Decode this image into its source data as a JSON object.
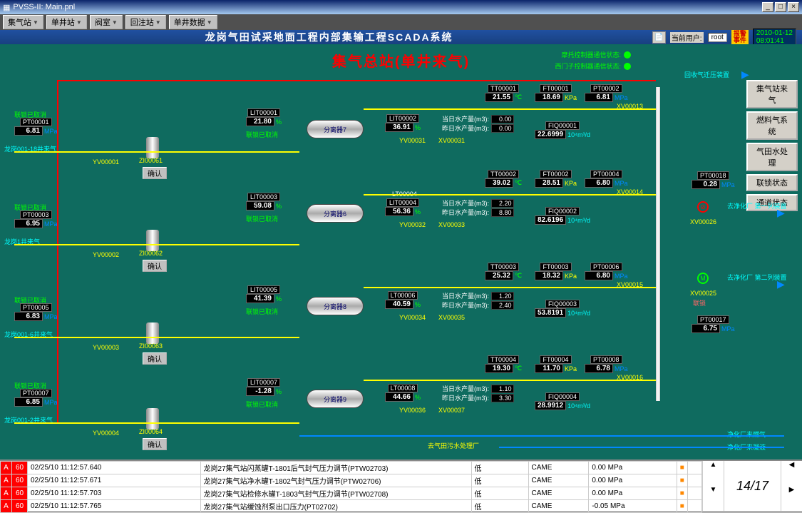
{
  "window": {
    "title": "PVSS-II: Main.pnl"
  },
  "toolbar": {
    "b1": "集气站",
    "b2": "单井站",
    "b3": "阀室",
    "b4": "回注站",
    "b5": "单井数据"
  },
  "header": {
    "title": "龙岗气田试采地面工程内部集输工程SCADA系统",
    "userlbl": "当前用户:",
    "user": "root",
    "alarm": "报警\n事件",
    "date": "2010-01-12",
    "time": "08:01:41"
  },
  "subtitle": "集气总站(单井来气)",
  "status": {
    "s1": "摩托控制器通信状态:",
    "s2": "西门子控制器通信状态:"
  },
  "sidebtns": {
    "b1": "集气站来气",
    "b2": "燃料气系统",
    "b3": "气田水处理",
    "b4": "联锁状态",
    "b5": "通道状态"
  },
  "pt": {
    "PT00001": "6.81",
    "PT00002": "6.81",
    "PT00003": "6.95",
    "PT00004": "6.80",
    "PT00005": "6.83",
    "PT00006": "6.80",
    "PT00007": "6.85",
    "PT00008": "6.78",
    "PT00017": "6.75",
    "PT00018": "0.28"
  },
  "tt": {
    "TT00001": "21.55",
    "TT00002": "39.02",
    "TT00003": "25.32",
    "TT00004": "19.30"
  },
  "ft": {
    "FT00001": "18.69",
    "FT00002": "28.51",
    "FT00003": "18.32",
    "FT00004": "11.70"
  },
  "lit": {
    "LIT00001": "21.80",
    "LIT00002": "36.91",
    "LIT00003": "59.08",
    "LIT00004": "56.36",
    "LIT00005": "41.39",
    "LIT00006": "40.59",
    "LIT00007": "-1.28",
    "LIT00008": "44.66"
  },
  "fiq": {
    "FIQ00001": "22.6999",
    "FIQ00002": "82.6196",
    "FIQ00003": "53.8191",
    "FIQ00004": "28.9912"
  },
  "yv": {
    "1": "YV00001",
    "2": "YV00002",
    "3": "YV00003",
    "4": "YV00004",
    "31": "YV00031",
    "32": "YV00032",
    "34": "YV00034",
    "36": "YV00036"
  },
  "xv": {
    "13": "XV00013",
    "14": "XV00014",
    "15": "XV00015",
    "16": "XV00016",
    "25": "XV00025",
    "26": "XV00026",
    "31": "XV00031",
    "33": "XV00033",
    "35": "XV00035",
    "37": "XV00037"
  },
  "zi": {
    "61": "ZI00061",
    "62": "ZI00062",
    "63": "ZI00063",
    "64": "ZI00064"
  },
  "lt": {
    "4": "LT00004",
    "6": "LT00006",
    "8": "LT00008"
  },
  "sep": {
    "7": "分离器7",
    "6": "分离器6",
    "8": "分离器8",
    "9": "分离器9"
  },
  "confirm": "确认",
  "lock": "联锁已取消",
  "day": {
    "today": "当日水产量(m3):",
    "yest": "昨日水产量(m3):"
  },
  "dv": {
    "1a": "0.00",
    "1b": "0.00",
    "2a": "2.20",
    "2b": "8.80",
    "3a": "1.20",
    "3b": "2.40",
    "4a": "1.10",
    "4b": "3.30"
  },
  "labels": {
    "l1": "龙岗001-18井来气",
    "l2": "龙岗1井来气",
    "l3": "龙岗001-6井来气",
    "l4": "龙岗001-2井来气",
    "out1": "回收气迁压装置",
    "out2": "去净化厂 第一列装置",
    "out3": "去净化厂 第二列装置",
    "bot1": "去气田污水处理厂",
    "bot2": "净化厂来燃气",
    "bot3": "净化厂来凝液"
  },
  "fiqunit": "10⁴m³/d",
  "alarms": {
    "rows": [
      {
        "t": "02/25/10 11:12:57.640",
        "d": "龙岗27集气站闪蒸罐T-1801后气封气压力调节(PTW02703)",
        "lv": "低",
        "st": "CAME",
        "v": "0.00 MPa"
      },
      {
        "t": "02/25/10 11:12:57.671",
        "d": "龙岗27集气站净水罐T-1802气封气压力调节(PTW02706)",
        "lv": "低",
        "st": "CAME",
        "v": "0.00 MPa"
      },
      {
        "t": "02/25/10 11:12:57.703",
        "d": "龙岗27集气站检修水罐T-1803气封气压力调节(PTW02708)",
        "lv": "低",
        "st": "CAME",
        "v": "0.00 MPa"
      },
      {
        "t": "02/25/10 11:12:57.765",
        "d": "龙岗27集气站缓蚀剂泵出口压力(PT02702)",
        "lv": "低",
        "st": "CAME",
        "v": "-0.05 MPa"
      }
    ],
    "page": "14/17"
  }
}
